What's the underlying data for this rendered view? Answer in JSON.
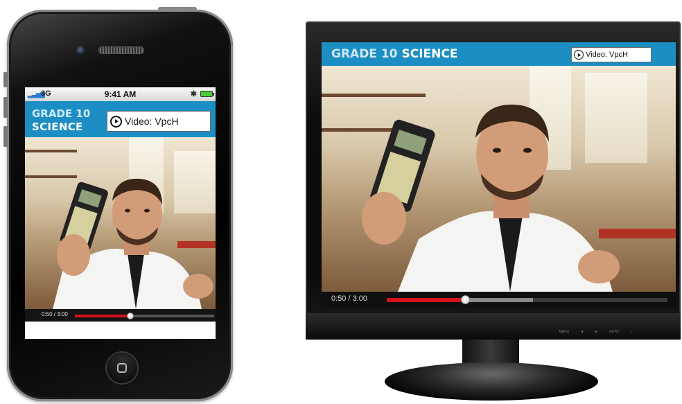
{
  "phone": {
    "status_bar": {
      "carrier": "3G",
      "time": "9:41 AM",
      "bluetooth_icon": "bluetooth-icon",
      "battery_icon": "battery-icon"
    },
    "header": {
      "grade": "GRADE 10",
      "subject": "SCIENCE",
      "video_label": "Video:  VpcH"
    },
    "player": {
      "timecode": "0:50 / 3:00",
      "progress": 0.4,
      "buffered": 0.4
    }
  },
  "monitor": {
    "header": {
      "grade": "GRADE 10",
      "subject": "SCIENCE",
      "video_label": "Video:  VpcH"
    },
    "player": {
      "timecode": "0:50 / 3:00",
      "progress": 0.28,
      "buffered": 0.52
    },
    "bezel": {
      "buttons": [
        "MENU",
        "◄",
        "►",
        "AUTO",
        "○"
      ]
    }
  },
  "colors": {
    "header_blue": "#1c8ec3",
    "progress_red": "#d8111a"
  },
  "icons": {
    "play": "play-circle-icon",
    "home": "home-button-icon"
  }
}
